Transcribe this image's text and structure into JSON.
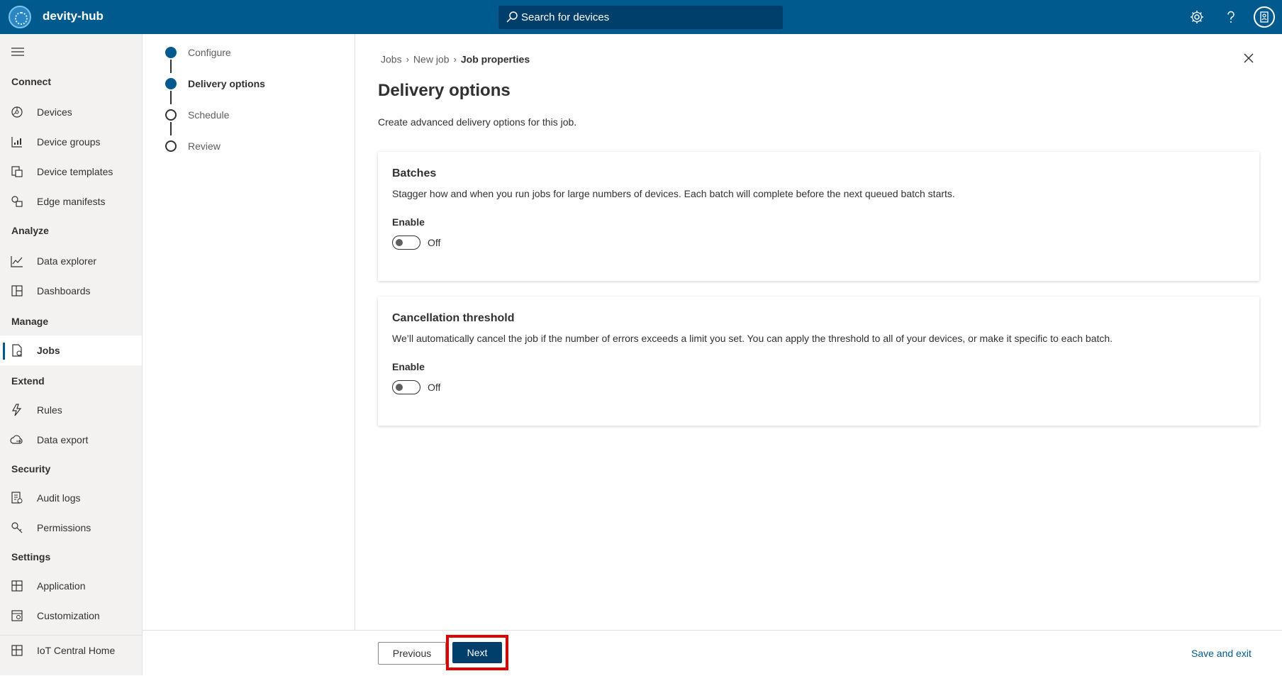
{
  "app": {
    "name": "devity-hub"
  },
  "search": {
    "placeholder": "Search for devices"
  },
  "topbar": {
    "icons": [
      "gear-icon",
      "help-icon",
      "account-icon"
    ]
  },
  "sidebar": {
    "sections": [
      {
        "label": "Connect",
        "items": [
          {
            "label": "Devices",
            "icon": "devices-icon"
          },
          {
            "label": "Device groups",
            "icon": "device-groups-icon"
          },
          {
            "label": "Device templates",
            "icon": "device-templates-icon"
          },
          {
            "label": "Edge manifests",
            "icon": "edge-manifests-icon"
          }
        ]
      },
      {
        "label": "Analyze",
        "items": [
          {
            "label": "Data explorer",
            "icon": "chart-icon"
          },
          {
            "label": "Dashboards",
            "icon": "dashboard-icon"
          }
        ]
      },
      {
        "label": "Manage",
        "items": [
          {
            "label": "Jobs",
            "icon": "jobs-icon",
            "active": true
          }
        ]
      },
      {
        "label": "Extend",
        "items": [
          {
            "label": "Rules",
            "icon": "rules-icon"
          },
          {
            "label": "Data export",
            "icon": "cloud-export-icon"
          }
        ]
      },
      {
        "label": "Security",
        "items": [
          {
            "label": "Audit logs",
            "icon": "audit-logs-icon"
          },
          {
            "label": "Permissions",
            "icon": "key-icon"
          }
        ]
      },
      {
        "label": "Settings",
        "items": [
          {
            "label": "Application",
            "icon": "application-icon"
          },
          {
            "label": "Customization",
            "icon": "customization-icon"
          },
          {
            "label": "IoT Central Home",
            "icon": "home-icon"
          }
        ]
      }
    ]
  },
  "steps": [
    {
      "label": "Configure",
      "state": "done"
    },
    {
      "label": "Delivery options",
      "state": "current"
    },
    {
      "label": "Schedule",
      "state": "todo"
    },
    {
      "label": "Review",
      "state": "todo"
    }
  ],
  "breadcrumb": [
    "Jobs",
    "New job",
    "Job properties"
  ],
  "page": {
    "title": "Delivery options",
    "subtitle": "Create advanced delivery options for this job."
  },
  "cards": [
    {
      "title": "Batches",
      "description": "Stagger how and when you run jobs for large numbers of devices. Each batch will complete before the next queued batch starts.",
      "enable_label": "Enable",
      "toggle_state": "Off"
    },
    {
      "title": "Cancellation threshold",
      "description": "We’ll automatically cancel the job if the number of errors exceeds a limit you set. You can apply the threshold to all of your devices, or make it specific to each batch.",
      "enable_label": "Enable",
      "toggle_state": "Off"
    }
  ],
  "footer": {
    "previous_label": "Previous",
    "next_label": "Next",
    "save_exit_label": "Save and exit"
  },
  "colors": {
    "brand": "#005a8e",
    "primary_button": "#003e6b",
    "highlight": "#e00000"
  }
}
